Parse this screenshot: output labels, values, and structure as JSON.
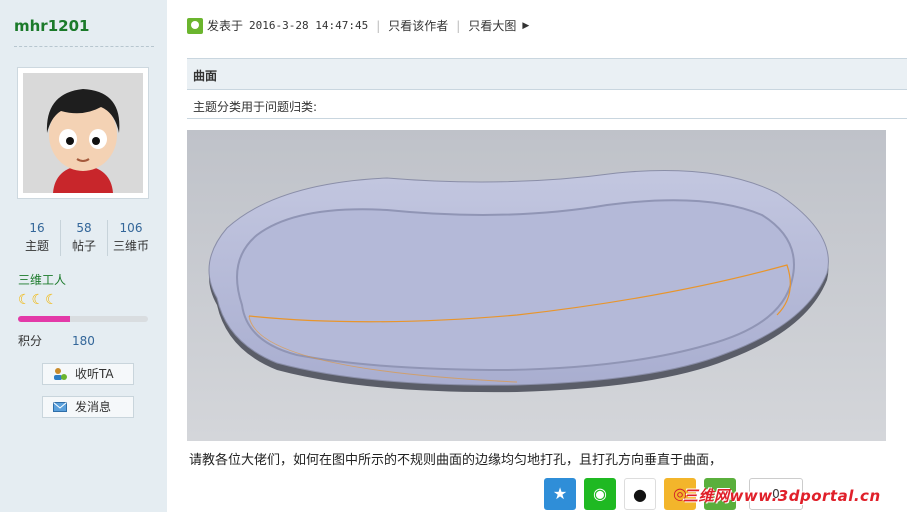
{
  "user": {
    "name": "mhr1201",
    "stats": [
      {
        "value": "16",
        "label": "主题"
      },
      {
        "value": "58",
        "label": "帖子"
      },
      {
        "value": "106",
        "label": "三维币"
      }
    ],
    "group": "三维工人",
    "level_progress": 0.4,
    "points_label": "积分",
    "points_value": "180",
    "follow_button": "收听TA",
    "message_button": "发消息"
  },
  "post": {
    "posted_label": "发表于",
    "timestamp": "2016-3-28 14:47:45",
    "author_only": "只看该作者",
    "big_image": "只看大图",
    "title": "曲面",
    "category_label": "主题分类用于问题归类:",
    "body": "请教各位大佬们，如何在图中所示的不规则曲面的边缘均匀地打孔，且打孔方向垂直于曲面，",
    "share_count": "0"
  },
  "watermark": "三维网www.3dportal.cn",
  "colors": {
    "sidebar_bg": "#e5edf2",
    "username": "#1b7a2a",
    "link": "#336699",
    "progress": "#e33aa8"
  },
  "share_icons": [
    "qzone-icon",
    "wechat-icon",
    "qq-icon",
    "weibo-icon",
    "plus-icon"
  ]
}
